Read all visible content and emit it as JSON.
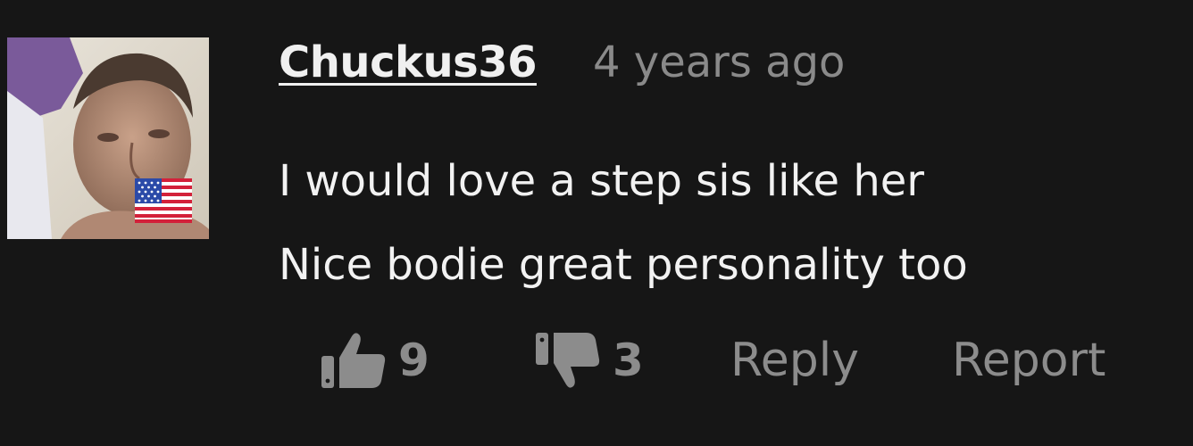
{
  "comment": {
    "username": "Chuckus36",
    "timestamp": "4 years ago",
    "body_lines": [
      "I would love a step sis like her",
      "Nice bodie great personality too"
    ],
    "avatar": {
      "alt": "user avatar photo",
      "flag_icon": "us-flag-icon"
    }
  },
  "actions": {
    "like_count": "9",
    "dislike_count": "3",
    "reply_label": "Reply",
    "report_label": "Report",
    "like_icon": "thumbs-up-icon",
    "dislike_icon": "thumbs-down-icon"
  },
  "colors": {
    "background": "#161616",
    "username": "#f0f0f0",
    "muted": "#8c8c8c",
    "body": "#f2f2f2"
  }
}
